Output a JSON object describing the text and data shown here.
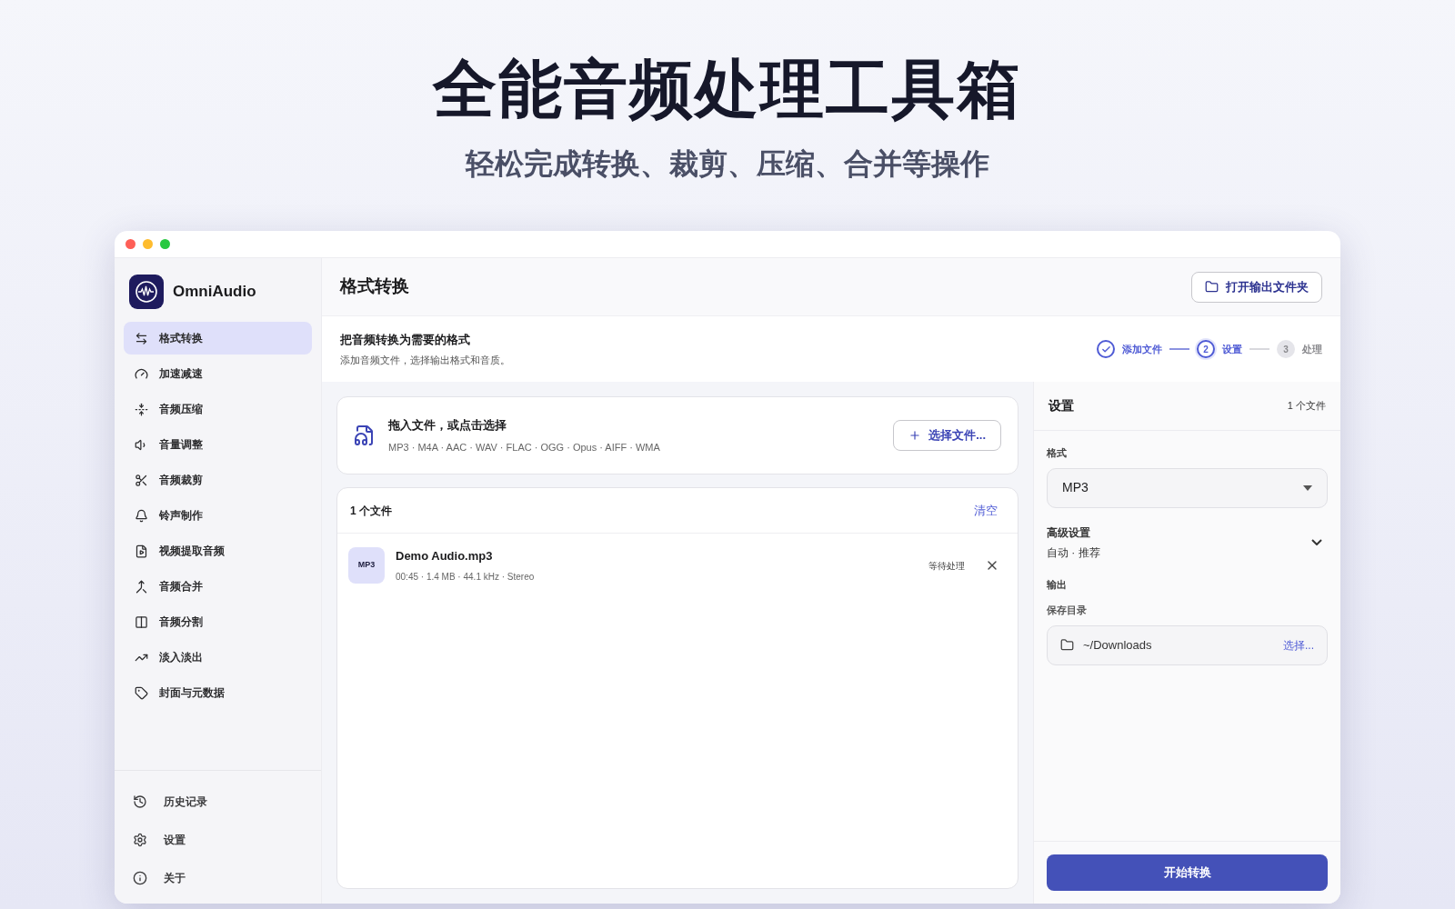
{
  "hero": {
    "title": "全能音频处理工具箱",
    "subtitle": "轻松完成转换、裁剪、压缩、合并等操作"
  },
  "app": {
    "name": "OmniAudio"
  },
  "sidebar": {
    "items": [
      {
        "label": "格式转换",
        "selected": true
      },
      {
        "label": "加速减速",
        "selected": false
      },
      {
        "label": "音频压缩",
        "selected": false
      },
      {
        "label": "音量调整",
        "selected": false
      },
      {
        "label": "音频裁剪",
        "selected": false
      },
      {
        "label": "铃声制作",
        "selected": false
      },
      {
        "label": "视频提取音频",
        "selected": false
      },
      {
        "label": "音频合并",
        "selected": false
      },
      {
        "label": "音频分割",
        "selected": false
      },
      {
        "label": "淡入淡出",
        "selected": false
      },
      {
        "label": "封面与元数据",
        "selected": false
      }
    ],
    "footer_items": [
      {
        "label": "历史记录"
      },
      {
        "label": "设置"
      },
      {
        "label": "关于"
      }
    ]
  },
  "header": {
    "title": "格式转换",
    "open_folder_button": "打开输出文件夹"
  },
  "intro": {
    "title": "把音频转换为需要的格式",
    "description": "添加音频文件，选择输出格式和音质。"
  },
  "steps": [
    {
      "label": "添加文件",
      "completed": true,
      "selected": false
    },
    {
      "marker": "2",
      "label": "设置",
      "completed": false,
      "selected": true
    },
    {
      "marker": "3",
      "label": "处理",
      "completed": false,
      "selected": false
    }
  ],
  "dropzone": {
    "title": "拖入文件，或点击选择",
    "formats": "MP3 · M4A · AAC · WAV · FLAC · OGG · Opus · AIFF · WMA",
    "button": "选择文件..."
  },
  "file_list": {
    "count": "1 个文件",
    "clear": "清空",
    "files": [
      {
        "badge": "MP3",
        "name": "Demo Audio.mp3",
        "meta": "00:45 · 1.4 MB · 44.1 kHz · Stereo",
        "status": "等待处理"
      }
    ]
  },
  "settings": {
    "title": "设置",
    "count": "1 个文件",
    "format_label": "格式",
    "format_value": "MP3",
    "advanced_title": "高级设置",
    "advanced_value": "自动 · 推荐",
    "advanced_expanded": false,
    "output_label": "输出",
    "dir_label": "保存目录",
    "dir_value": "~/Downloads",
    "dir_button": "选择...",
    "start_button": "开始转换"
  }
}
